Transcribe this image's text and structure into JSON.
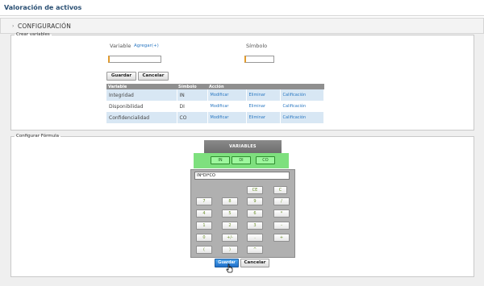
{
  "page": {
    "title": "Valoración de activos"
  },
  "section": {
    "title": "CONFIGURACIÓN"
  },
  "crear": {
    "legend": "Crear variables",
    "variable_label": "Variable",
    "add_link": "Agregar(+)",
    "symbol_label": "Símbolo",
    "variable_value": "",
    "symbol_value": "",
    "save_label": "Guardar",
    "cancel_label": "Cancelar",
    "table": {
      "headers": [
        "Variable",
        "Símbolo",
        "Acción"
      ],
      "rows": [
        {
          "variable": "Integridad",
          "symbol": "IN",
          "modify": "Modificar",
          "delete": "Eliminar",
          "rate": "Calificación"
        },
        {
          "variable": "Disponibilidad",
          "symbol": "DI",
          "modify": "Modificar",
          "delete": "Eliminar",
          "rate": "Calificación"
        },
        {
          "variable": "Confidencialidad",
          "symbol": "CO",
          "modify": "Modificar",
          "delete": "Eliminar",
          "rate": "Calificación"
        }
      ]
    }
  },
  "formula": {
    "legend": "Configurar Fórmula",
    "variables_title": "VARIABLES",
    "variable_buttons": [
      "IN",
      "DI",
      "CO"
    ],
    "expression": "IN*DI*CO",
    "keys": {
      "ce": "CE",
      "c": "C",
      "k7": "7",
      "k8": "8",
      "k9": "9",
      "div": "/",
      "k4": "4",
      "k5": "5",
      "k6": "6",
      "mul": "*",
      "k1": "1",
      "k2": "2",
      "k3": "3",
      "sub": "-",
      "k0": "0",
      "sign": "+/-",
      "dot": ".",
      "add": "+",
      "lparen": "(",
      "rparen": ")",
      "pow": "^"
    },
    "save_label": "Guardar",
    "cancel_label": "Cancelar"
  },
  "colors": {
    "accent": "#2a78c2",
    "title": "#2a4f73",
    "variables_green": "#7ee07e",
    "primary_button": "#1f6fc9"
  }
}
